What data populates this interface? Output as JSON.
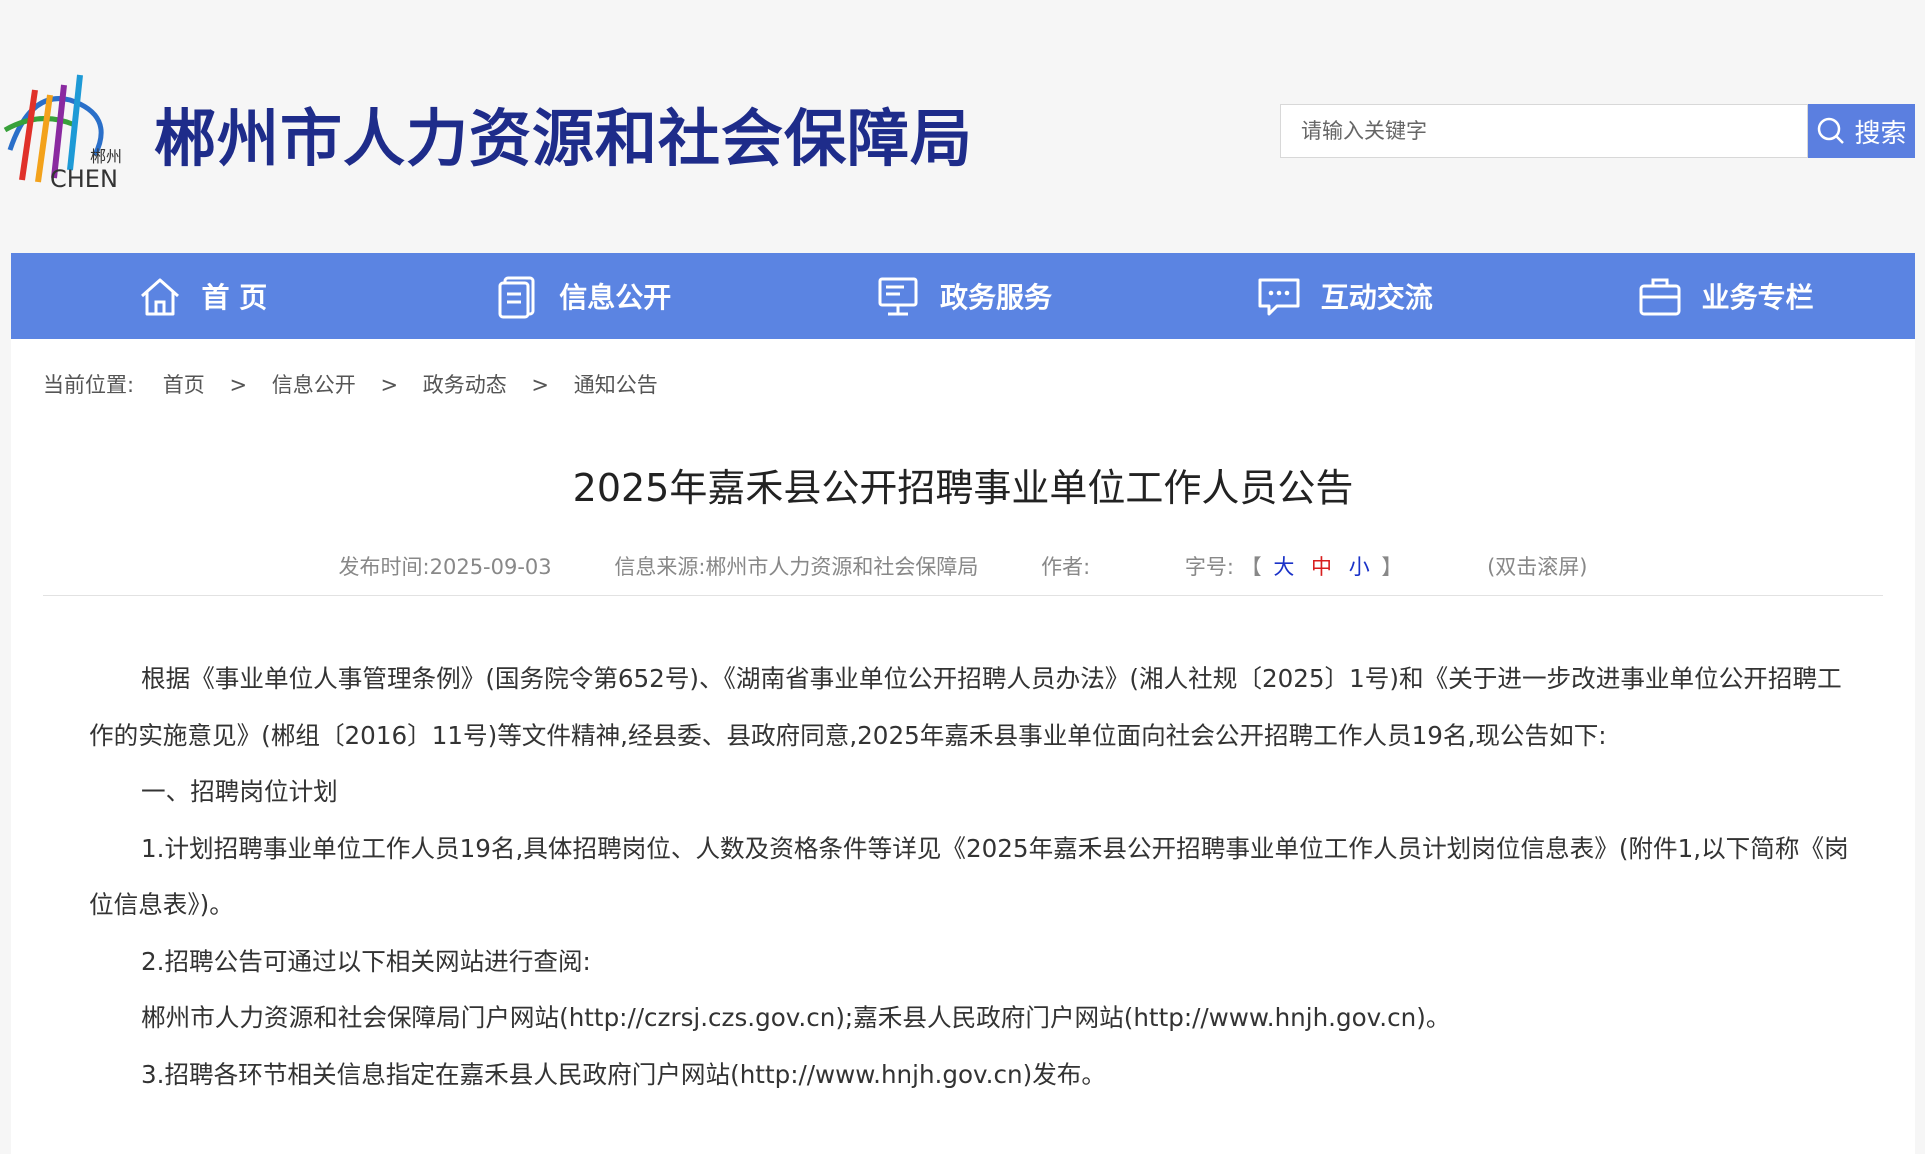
{
  "site": {
    "title": "郴州市人力资源和社会保障局",
    "logo_text_cn": "郴州",
    "logo_text_en": "CHEN"
  },
  "search": {
    "placeholder": "请输入关键字",
    "button_label": "搜索"
  },
  "nav": {
    "items": [
      {
        "label": "首 页",
        "icon": "home-icon"
      },
      {
        "label": "信息公开",
        "icon": "document-icon"
      },
      {
        "label": "政务服务",
        "icon": "monitor-icon"
      },
      {
        "label": "互动交流",
        "icon": "chat-icon"
      },
      {
        "label": "业务专栏",
        "icon": "briefcase-icon"
      }
    ]
  },
  "breadcrumb": {
    "prefix": "当前位置:",
    "items": [
      "首页",
      "信息公开",
      "政务动态",
      "通知公告"
    ],
    "separator": ">"
  },
  "article": {
    "title": "2025年嘉禾县公开招聘事业单位工作人员公告",
    "publish_time": "发布时间:2025-09-03",
    "source": "信息来源:郴州市人力资源和社会保障局",
    "author": "作者:",
    "font_size_label": "字号:",
    "font_size_open": "【",
    "font_size_close": "】",
    "font_sizes": [
      "大",
      "中",
      "小"
    ],
    "scroll_hint": "(双击滚屏)",
    "paragraphs": [
      "根据《事业单位人事管理条例》(国务院令第652号)、《湖南省事业单位公开招聘人员办法》(湘人社规〔2025〕1号)和《关于进一步改进事业单位公开招聘工作的实施意见》(郴组〔2016〕11号)等文件精神,经县委、县政府同意,2025年嘉禾县事业单位面向社会公开招聘工作人员19名,现公告如下:",
      "一、招聘岗位计划",
      "1.计划招聘事业单位工作人员19名,具体招聘岗位、人数及资格条件等详见《2025年嘉禾县公开招聘事业单位工作人员计划岗位信息表》(附件1,以下简称《岗位信息表》)。",
      "2.招聘公告可通过以下相关网站进行查阅:",
      "郴州市人力资源和社会保障局门户网站(http://czrsj.czs.gov.cn);嘉禾县人民政府门户网站(http://www.hnjh.gov.cn)。",
      "3.招聘各环节相关信息指定在嘉禾县人民政府门户网站(http://www.hnjh.gov.cn)发布。"
    ]
  },
  "colors": {
    "title": "#1e2c8a",
    "nav_bg": "#5b84e2",
    "search_btn": "#5b7fe0",
    "font_size_link": "#1a32c8",
    "font_size_mid": "#d81e1e"
  }
}
